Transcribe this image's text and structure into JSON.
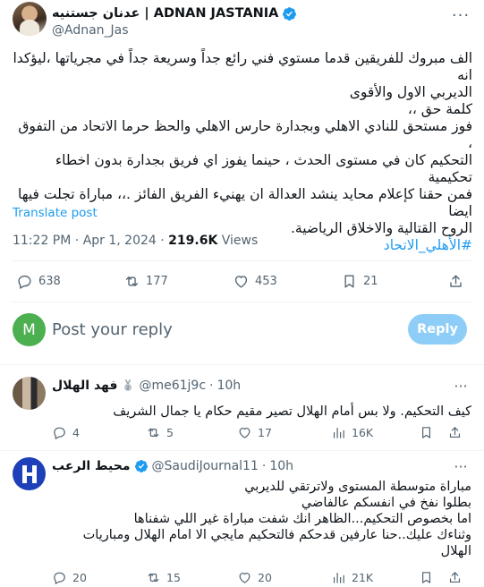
{
  "tweet": {
    "author_name": "عدنان جستنيه | ADNAN JASTANIA",
    "handle": "@Adnan_Jas",
    "text_lines": [
      "الف مبروك للفريقين قدما مستوي فني رائع جداً وسريعة جداً في مجرياتها ،ليؤكدا انه",
      "الديربي الاول والأقوى",
      "كلمة حق ،،",
      "فوز مستحق للنادي الاهلي وبجدارة حارس الاهلي والحظ حرما الاتحاد من التفوق ،",
      "التحكيم كان في مستوى الحدث ، حينما يفوز اي فريق بجدارة بدون اخطاء تحكيمية",
      "فمن حقنا كإعلام محايد ينشد العدالة ان يهنيء الفريق الفائز .،، مباراة تجلت فيها ايضا",
      "الروح القتالية والاخلاق الرياضية."
    ],
    "hashtag": "#الأهلي_الاتحاد",
    "translate_label": "Translate post",
    "time": "11:22 PM",
    "date": "Apr 1, 2024",
    "views_count": "219.6K",
    "views_label": "Views",
    "stats": {
      "replies": "638",
      "reposts": "177",
      "likes": "453",
      "bookmarks": "21"
    }
  },
  "compose": {
    "avatar_letter": "M",
    "placeholder": "Post your reply",
    "reply_label": "Reply"
  },
  "replies": [
    {
      "name": "فهد الهلال",
      "handle": "@me61j9c",
      "time": "10h",
      "lines": [
        "كيف التحكيم. ولا بس أمام الهلال تصير مقيم حكام يا جمال الشريف"
      ],
      "stats": {
        "replies": "4",
        "reposts": "5",
        "likes": "17",
        "views": "16K"
      }
    },
    {
      "name": "محيط الرعب",
      "handle": "@SaudiJournal11",
      "time": "10h",
      "lines": [
        "مباراة متوسطة المستوى ولاترتقي للديربي",
        "بطلوا نفخ في انفسكم عالفاضي",
        "اما بخصوص التحكيم...الظاهر انك شفت مباراة غير اللي شفناها",
        "وثناءك عليك..حنا عارفين قدحكم فالتحكيم مايجي الا امام الهلال ومباريات",
        "الهلال"
      ],
      "stats": {
        "replies": "20",
        "reposts": "15",
        "likes": "20",
        "views": "21K"
      }
    }
  ],
  "colors": {
    "accent": "#1d9bf0",
    "muted": "#536471",
    "verified": "#1d9bf0",
    "reply_button": "#8ecdf8"
  }
}
